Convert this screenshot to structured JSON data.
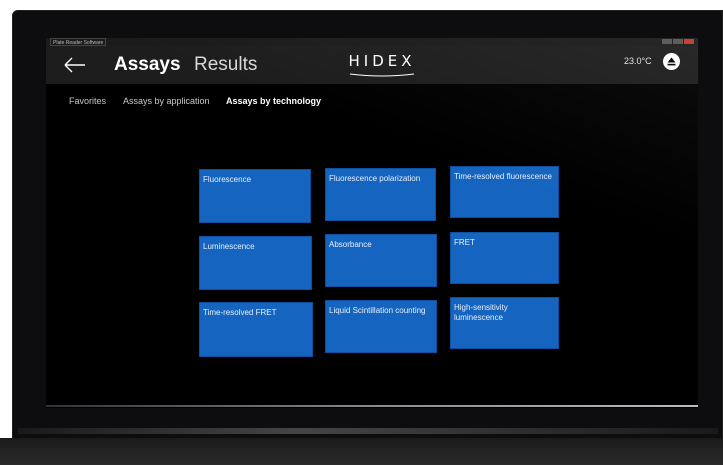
{
  "window": {
    "app_title": "Plate Reader Software"
  },
  "header": {
    "title": "Assays",
    "secondary_tab": "Results",
    "logo": "HIDEX",
    "temperature": "23.0°C"
  },
  "subtabs": [
    {
      "label": "Favorites",
      "active": false
    },
    {
      "label": "Assays by application",
      "active": false
    },
    {
      "label": "Assays by technology",
      "active": true
    }
  ],
  "tiles": [
    {
      "label": "Fluorescence"
    },
    {
      "label": "Fluorescence polarization"
    },
    {
      "label": "Time-resolved fluorescence"
    },
    {
      "label": "Luminescence"
    },
    {
      "label": "Absorbance"
    },
    {
      "label": "FRET"
    },
    {
      "label": "Time-resolved FRET"
    },
    {
      "label": "Liquid Scintillation counting"
    },
    {
      "label": "High-sensitivity luminescence"
    }
  ],
  "colors": {
    "tile": "#1565c0",
    "header": "#1d1d1d",
    "background": "#000000"
  }
}
